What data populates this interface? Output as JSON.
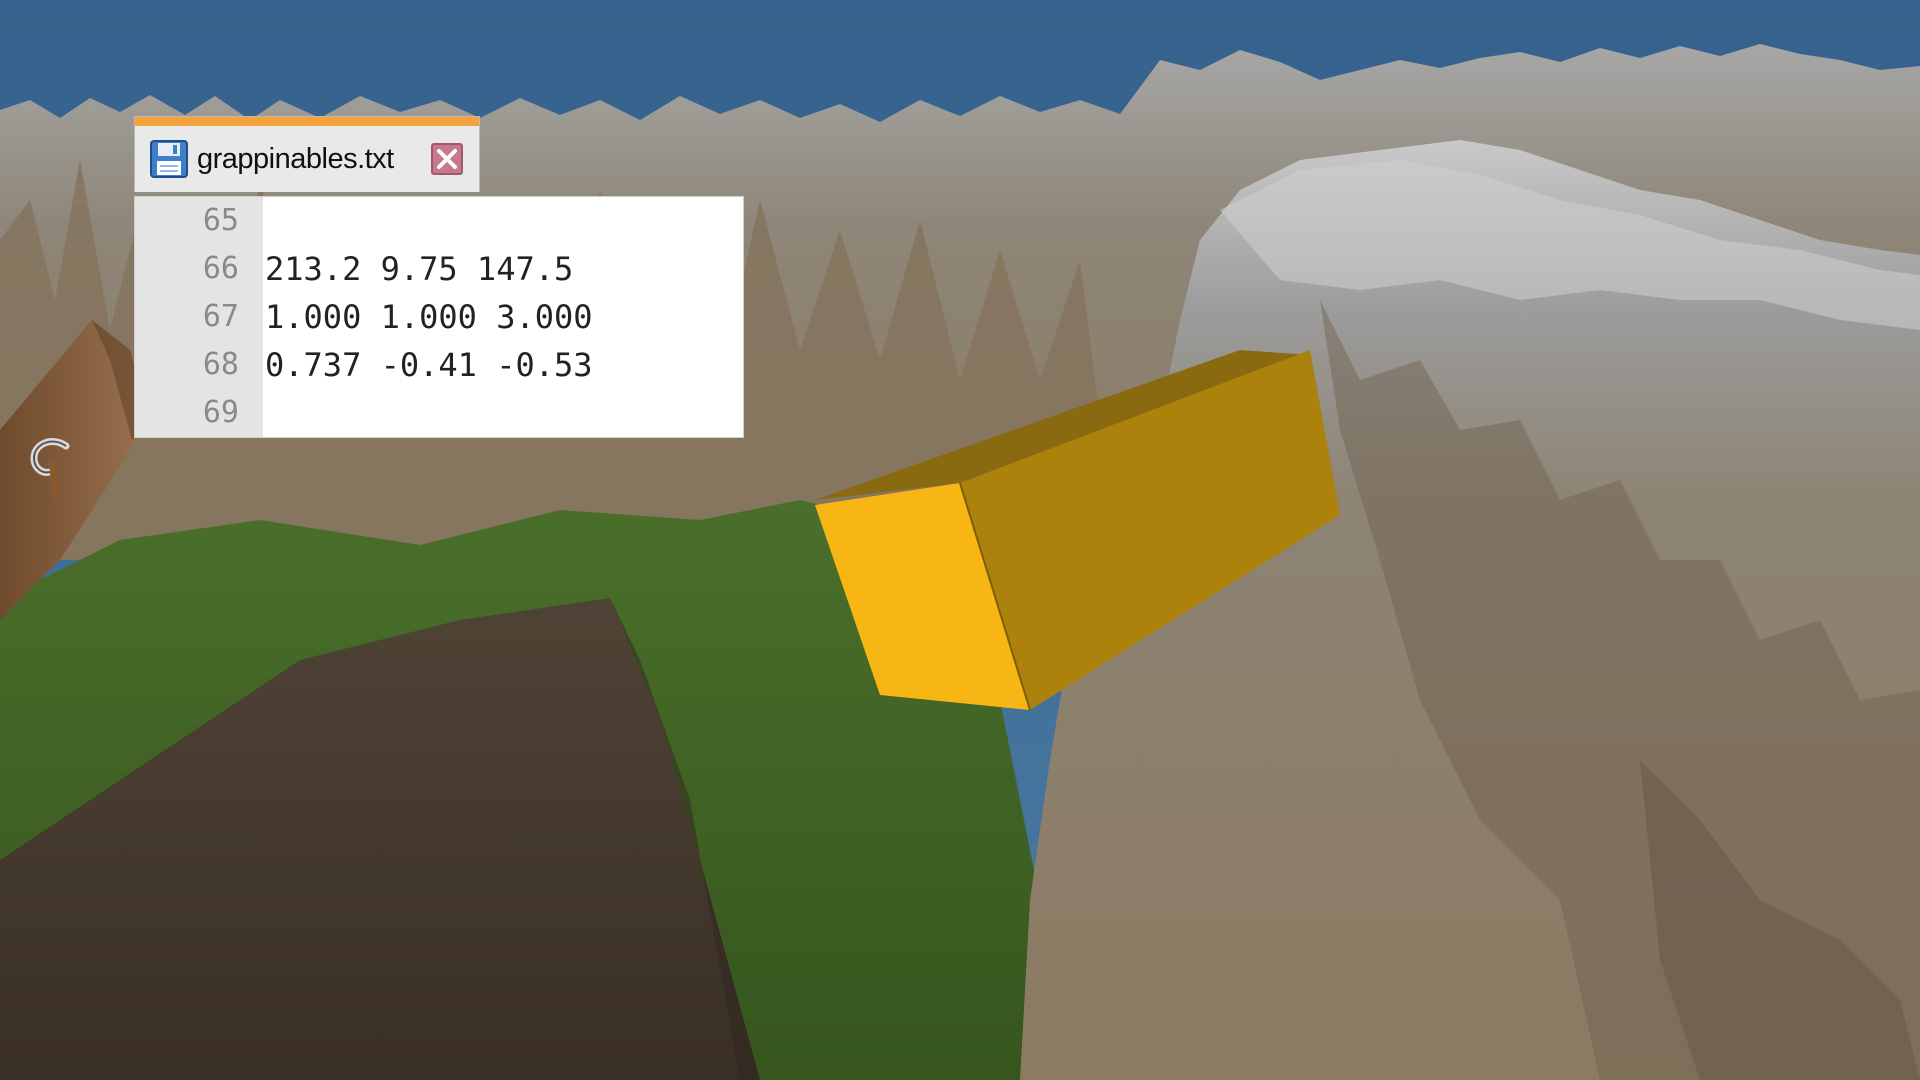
{
  "editor": {
    "tab": {
      "filename": "grappinables.txt",
      "file_icon": "save-icon",
      "close_icon": "close-icon",
      "accent_color": "#f4a23a"
    },
    "lines": [
      {
        "number": "65",
        "text": ""
      },
      {
        "number": "66",
        "text": "213.2 9.75 147.5"
      },
      {
        "number": "67",
        "text": "1.000 1.000 3.000"
      },
      {
        "number": "68",
        "text": "0.737 -0.41 -0.53"
      },
      {
        "number": "69",
        "text": ""
      }
    ]
  },
  "scene": {
    "sky_color": "#3c6b94",
    "grass_color": "#3d5e22",
    "rock_color": "#8f7c62",
    "box_color": "#f4ad12",
    "hud_icon": "grappling-hook-icon"
  }
}
